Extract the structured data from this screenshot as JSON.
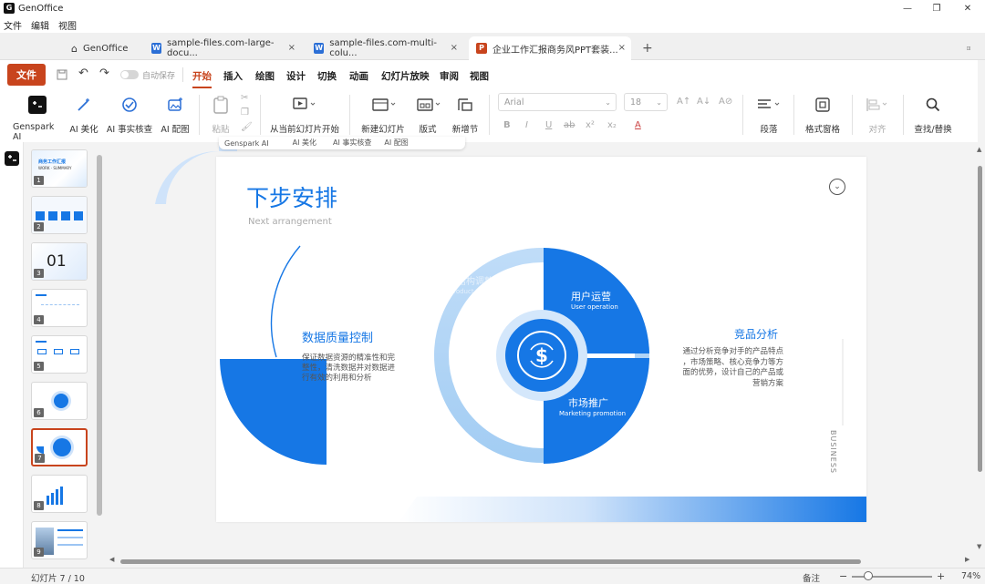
{
  "window": {
    "app_title": "GenOffice",
    "minimize_icon": "minimize-icon",
    "maximize_icon": "maximize-icon",
    "close_icon": "close-icon"
  },
  "menubar": [
    "文件",
    "编辑",
    "视图"
  ],
  "tabs": [
    {
      "label": "GenOffice",
      "icon": "home-icon"
    },
    {
      "label": "sample-files.com-large-docu...",
      "badge": "W",
      "badge_color": "#2b6fd6"
    },
    {
      "label": "sample-files.com-multi-colu...",
      "badge": "W",
      "badge_color": "#2b6fd6"
    },
    {
      "label": "企业工作汇报商务风PPT套装...",
      "badge": "P",
      "badge_color": "#c8441d",
      "active": true
    }
  ],
  "ribbon": {
    "file_label": "文件",
    "autosave_label": "自动保存",
    "tabs": [
      "开始",
      "插入",
      "绘图",
      "设计",
      "切换",
      "动画",
      "幻灯片放映",
      "审阅",
      "视图"
    ],
    "active_tab": "开始",
    "tools": {
      "genspark": "Genspark AI",
      "ai_beautify": "AI 美化",
      "ai_factcheck": "AI 事实核查",
      "ai_image": "AI 配图",
      "paste": "粘贴",
      "play_from_current": "从当前幻灯片开始",
      "new_slide": "新建幻灯片",
      "layout": "版式",
      "new_section": "新增节",
      "font_name": "Arial",
      "font_size": "18",
      "paragraph": "段落",
      "format_pane": "格式窗格",
      "align": "对齐",
      "find_replace": "查找/替换"
    },
    "format_buttons": [
      "B",
      "I",
      "U",
      "ab",
      "x²",
      "x₂",
      "A"
    ]
  },
  "floating_toolbar": [
    "Genspark AI",
    "AI 美化",
    "AI 事实核查",
    "AI 配图"
  ],
  "thumbnails": [
    {
      "num": "1",
      "title": "商务工作汇报",
      "subtitle": "WORK · SUMMARY"
    },
    {
      "num": "2"
    },
    {
      "num": "3",
      "big": "01"
    },
    {
      "num": "4"
    },
    {
      "num": "5"
    },
    {
      "num": "6"
    },
    {
      "num": "7",
      "selected": true
    },
    {
      "num": "8"
    },
    {
      "num": "9"
    }
  ],
  "slide": {
    "title": "下步安排",
    "subtitle": "Next arrangement",
    "left_heading": "数据质量控制",
    "left_body": [
      "保证数据资源的精准性和完",
      "整性，清洗数据并对数据进",
      "行有效的利用和分析"
    ],
    "right_heading": "竞品分析",
    "right_body": [
      "通过分析竞争对手的产品特点",
      "，市场策略、核心竞争力等方",
      "面的优势，设计自己的产品或",
      "营销方案"
    ],
    "q1_title": "用户运营",
    "q1_sub": "User operation",
    "q2_title": "市场推广",
    "q2_sub": "Marketing promotion",
    "hidden_title": "结构调整",
    "hidden_sub": "Product adjust",
    "vertical_text": "BUSINESS",
    "accent": "#1677e5",
    "light": "#a9cff5"
  },
  "status": {
    "slide_counter": "幻灯片 7 / 10",
    "notes": "备注",
    "zoom_minus": "−",
    "zoom_plus": "+",
    "zoom": "74%",
    "zoom_level": 0.2
  }
}
